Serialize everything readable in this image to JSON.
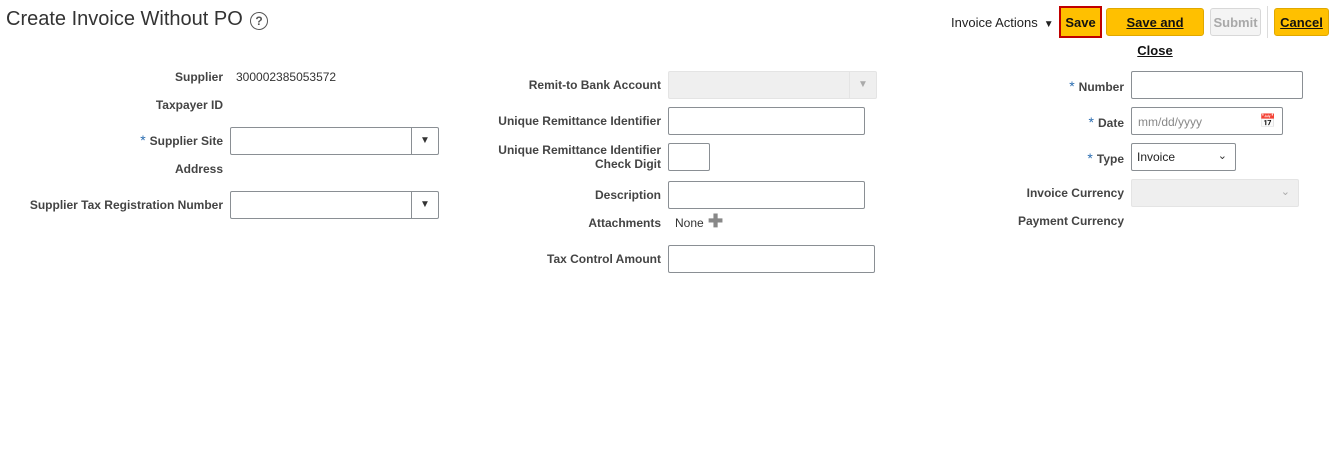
{
  "header": {
    "title": "Create Invoice Without PO",
    "help_icon": "?",
    "actions_menu": "Invoice Actions",
    "buttons": {
      "save": "Save",
      "save_and_close": "Save and Close",
      "submit": "Submit",
      "cancel": "Cancel"
    }
  },
  "left": {
    "supplier_label": "Supplier",
    "supplier_value": "300002385053572",
    "taxpayer_label": "Taxpayer ID",
    "supplier_site_label": "Supplier Site",
    "address_label": "Address",
    "tax_reg_label": "Supplier Tax Registration Number"
  },
  "middle": {
    "remit_bank_label": "Remit-to Bank Account",
    "uri_label": "Unique Remittance Identifier",
    "uri_check_label_1": "Unique Remittance Identifier",
    "uri_check_label_2": "Check Digit",
    "description_label": "Description",
    "attachments_label": "Attachments",
    "attachments_value": "None",
    "tax_control_label": "Tax Control Amount"
  },
  "right": {
    "number_label": "Number",
    "date_label": "Date",
    "date_placeholder": "mm/dd/yyyy",
    "type_label": "Type",
    "type_value": "Invoice",
    "invoice_currency_label": "Invoice Currency",
    "payment_currency_label": "Payment Currency"
  },
  "colors": {
    "button_primary": "#ffc000",
    "required_star": "#2a6cb0",
    "save_focus_border": "#c00000"
  }
}
